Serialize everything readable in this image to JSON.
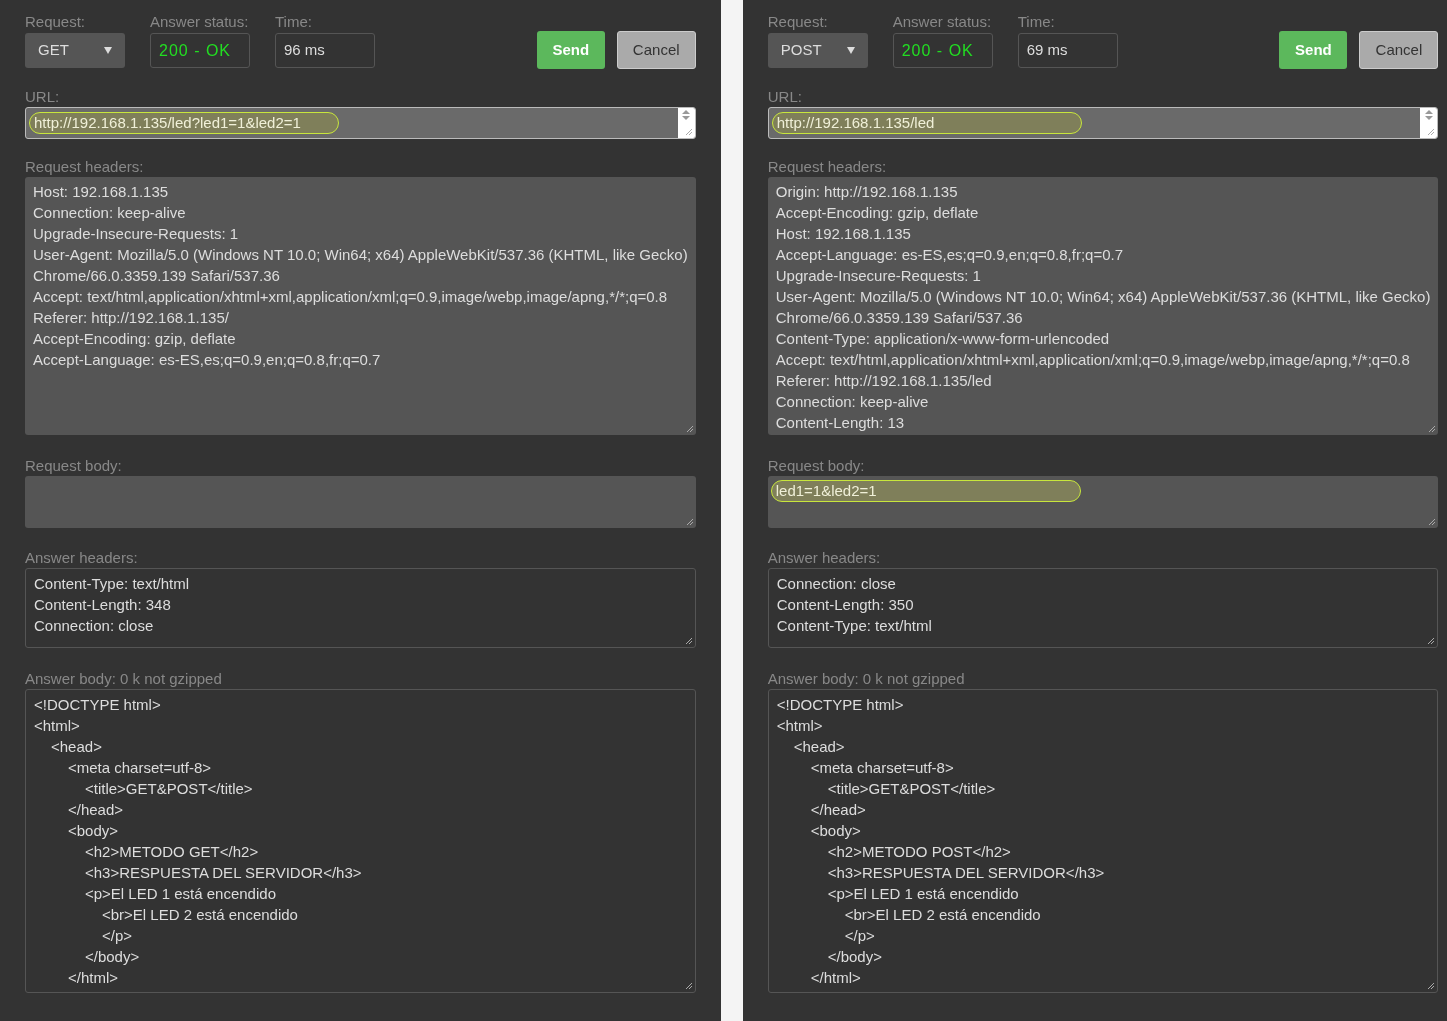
{
  "panels": [
    {
      "request": {
        "label": "Request:",
        "value": "GET"
      },
      "answer_status": {
        "label": "Answer status:",
        "value": "200 - OK"
      },
      "time": {
        "label": "Time:",
        "value": "96 ms"
      },
      "send": "Send",
      "cancel": "Cancel",
      "url": {
        "label": "URL:",
        "value": "http://192.168.1.135/led?led1=1&led2=1",
        "highlighted": true
      },
      "request_headers": {
        "label": "Request headers:",
        "lines": [
          "Host: 192.168.1.135",
          "Connection: keep-alive",
          "Upgrade-Insecure-Requests: 1",
          "User-Agent: Mozilla/5.0 (Windows NT 10.0; Win64; x64) AppleWebKit/537.36 (KHTML, like Gecko)",
          "Chrome/66.0.3359.139 Safari/537.36",
          "Accept: text/html,application/xhtml+xml,application/xml;q=0.9,image/webp,image/apng,*/*;q=0.8",
          "Referer: http://192.168.1.135/",
          "Accept-Encoding: gzip, deflate",
          "Accept-Language: es-ES,es;q=0.9,en;q=0.8,fr;q=0.7"
        ]
      },
      "request_body": {
        "label": "Request body:"
      },
      "answer_headers": {
        "label": "Answer headers:",
        "lines": [
          "Content-Type: text/html",
          "Content-Length: 348",
          "Connection: close"
        ]
      },
      "answer_body": {
        "label": "Answer body: 0 k not gzipped",
        "lines": [
          {
            "text": "<!DOCTYPE html>"
          },
          {
            "text": "<html>",
            "children": [
              {
                "text": "<head>",
                "children": [
                  {
                    "text": "<meta charset=utf-8>",
                    "children": [
                      {
                        "text": "<title>GET&POST</title>"
                      }
                    ]
                  },
                  {
                    "text": "</head>"
                  },
                  {
                    "text": "<body>",
                    "children": [
                      {
                        "text": "<h2>METODO GET</h2>"
                      },
                      {
                        "text": "<h3>RESPUESTA DEL SERVIDOR</h3>"
                      },
                      {
                        "text": "<p>El LED 1 está encendido",
                        "children": [
                          {
                            "text": "<br>El LED 2 está encendido"
                          },
                          {
                            "text": "</p>"
                          }
                        ]
                      },
                      {
                        "text": "</body>"
                      }
                    ]
                  },
                  {
                    "text": "</html>"
                  }
                ]
              }
            ]
          }
        ]
      }
    },
    {
      "request": {
        "label": "Request:",
        "value": "POST"
      },
      "answer_status": {
        "label": "Answer status:",
        "value": "200 - OK"
      },
      "time": {
        "label": "Time:",
        "value": "69 ms"
      },
      "send": "Send",
      "cancel": "Cancel",
      "url": {
        "label": "URL:",
        "value": "http://192.168.1.135/led",
        "highlighted": true
      },
      "request_headers": {
        "label": "Request headers:",
        "lines": [
          "Origin: http://192.168.1.135",
          "Accept-Encoding: gzip, deflate",
          "Host: 192.168.1.135",
          "Accept-Language: es-ES,es;q=0.9,en;q=0.8,fr;q=0.7",
          "Upgrade-Insecure-Requests: 1",
          "User-Agent: Mozilla/5.0 (Windows NT 10.0; Win64; x64) AppleWebKit/537.36 (KHTML, like Gecko)",
          "Chrome/66.0.3359.139 Safari/537.36",
          "Content-Type: application/x-www-form-urlencoded",
          "Accept: text/html,application/xhtml+xml,application/xml;q=0.9,image/webp,image/apng,*/*;q=0.8",
          "Referer: http://192.168.1.135/led",
          "Connection: keep-alive",
          "Content-Length: 13"
        ]
      },
      "request_body": {
        "label": "Request body:",
        "value": "led1=1&led2=1",
        "highlighted": true
      },
      "answer_headers": {
        "label": "Answer headers:",
        "lines": [
          "Connection: close",
          "Content-Length: 350",
          "Content-Type: text/html"
        ]
      },
      "answer_body": {
        "label": "Answer body: 0 k not gzipped",
        "lines": [
          {
            "text": "<!DOCTYPE html>"
          },
          {
            "text": "<html>",
            "children": [
              {
                "text": "<head>",
                "children": [
                  {
                    "text": "<meta charset=utf-8>",
                    "children": [
                      {
                        "text": "<title>GET&POST</title>"
                      }
                    ]
                  },
                  {
                    "text": "</head>"
                  },
                  {
                    "text": "<body>",
                    "children": [
                      {
                        "text": "<h2>METODO POST</h2>"
                      },
                      {
                        "text": "<h3>RESPUESTA DEL SERVIDOR</h3>"
                      },
                      {
                        "text": "<p>El LED 1 está encendido",
                        "children": [
                          {
                            "text": "<br>El LED 2 está encendido"
                          },
                          {
                            "text": "</p>"
                          }
                        ]
                      },
                      {
                        "text": "</body>"
                      }
                    ]
                  },
                  {
                    "text": "</html>"
                  }
                ]
              }
            ]
          }
        ]
      }
    }
  ]
}
